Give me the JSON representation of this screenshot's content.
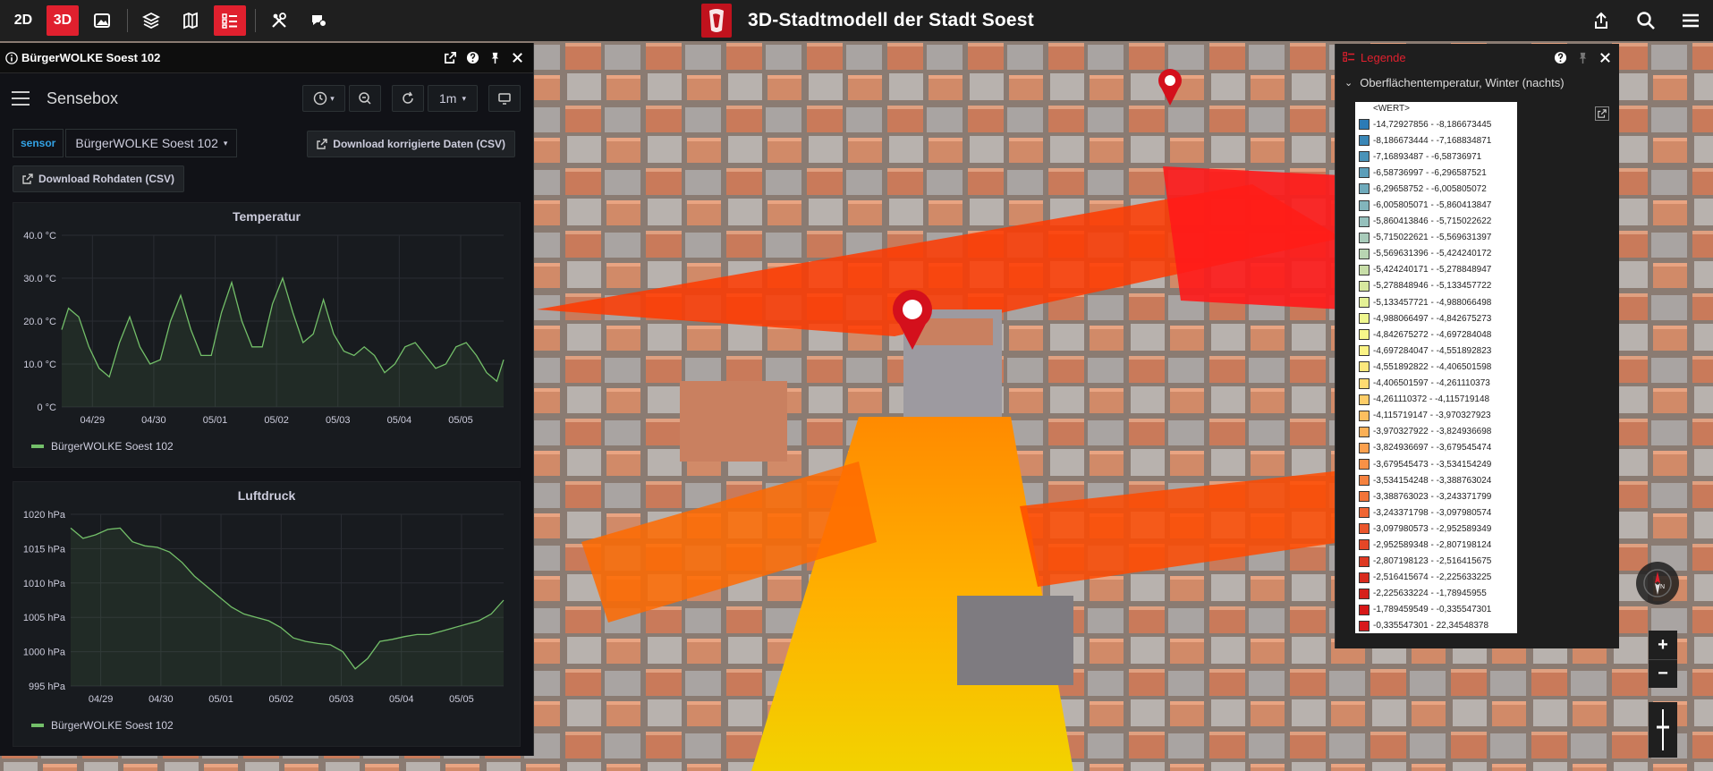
{
  "topbar": {
    "btn_2d": "2D",
    "btn_3d": "3D",
    "title": "3D-Stadtmodell der Stadt Soest",
    "accent": "#e0202e"
  },
  "left_panel": {
    "window_title": "BürgerWOLKE Soest 102",
    "dashboard_title": "Sensebox",
    "refresh_interval": "1m",
    "variable_label": "sensor",
    "variable_value": "BürgerWOLKE Soest 102",
    "download_corrected": "Download korrigierte Daten (CSV)",
    "download_raw": "Download Rohdaten (CSV)"
  },
  "chart_data": [
    {
      "type": "area",
      "title": "Temperatur",
      "ylim": [
        0,
        40
      ],
      "yticks": [
        "0 °C",
        "10.0 °C",
        "20.0 °C",
        "30.0 °C",
        "40.0 °C"
      ],
      "xticks": [
        "04/29",
        "04/30",
        "05/01",
        "05/02",
        "05/03",
        "05/04",
        "05/05"
      ],
      "series": [
        {
          "name": "BürgerWOLKE Soest 102",
          "color": "#73bf69",
          "x": [
            0,
            0.1,
            0.25,
            0.4,
            0.55,
            0.7,
            0.85,
            1.0,
            1.15,
            1.3,
            1.45,
            1.6,
            1.75,
            1.9,
            2.05,
            2.2,
            2.35,
            2.5,
            2.65,
            2.8,
            2.95,
            3.1,
            3.25,
            3.4,
            3.55,
            3.7,
            3.85,
            4.0,
            4.15,
            4.3,
            4.45,
            4.6,
            4.75,
            4.9,
            5.05,
            5.2,
            5.35,
            5.5,
            5.65,
            5.8,
            5.95,
            6.1,
            6.25,
            6.4,
            6.5
          ],
          "y": [
            18,
            23,
            21,
            14,
            9,
            7,
            15,
            21,
            14,
            10,
            11,
            20,
            26,
            18,
            12,
            12,
            22,
            29,
            20,
            14,
            14,
            24,
            30,
            22,
            15,
            17,
            25,
            17,
            13,
            12,
            14,
            12,
            8,
            10,
            14,
            15,
            12,
            9,
            10,
            14,
            15,
            12,
            8,
            6,
            11
          ]
        }
      ]
    },
    {
      "type": "area",
      "title": "Luftdruck",
      "ylim": [
        995,
        1020
      ],
      "yticks": [
        "995 hPa",
        "1000 hPa",
        "1005 hPa",
        "1010 hPa",
        "1015 hPa",
        "1020 hPa"
      ],
      "xticks": [
        "04/29",
        "04/30",
        "05/01",
        "05/02",
        "05/03",
        "05/04",
        "05/05"
      ],
      "series": [
        {
          "name": "BürgerWOLKE Soest 102",
          "color": "#73bf69",
          "x": [
            0,
            0.2,
            0.4,
            0.6,
            0.8,
            1.0,
            1.2,
            1.4,
            1.6,
            1.8,
            2.0,
            2.2,
            2.4,
            2.6,
            2.8,
            3.0,
            3.2,
            3.4,
            3.6,
            3.8,
            4.0,
            4.2,
            4.4,
            4.6,
            4.8,
            5.0,
            5.2,
            5.4,
            5.6,
            5.8,
            6.0,
            6.2,
            6.4,
            6.6,
            6.8,
            7.0
          ],
          "y": [
            1018,
            1016.5,
            1017,
            1017.8,
            1018,
            1016,
            1015.4,
            1015.2,
            1014.5,
            1013,
            1011,
            1009.5,
            1008,
            1006.5,
            1005.5,
            1005,
            1004.5,
            1003.5,
            1002,
            1001.5,
            1001.2,
            1001,
            1000,
            997.5,
            999,
            1001.5,
            1001.8,
            1002.2,
            1002.5,
            1002.5,
            1003,
            1003.5,
            1004,
            1004.5,
            1005.5,
            1007.5
          ]
        }
      ]
    }
  ],
  "legend_panel": {
    "title": "Legende",
    "layer_name": "Oberflächentemperatur, Winter (nachts)",
    "header": "<WERT>",
    "items": [
      {
        "label": "-14,72927856 - -8,186673445",
        "color": "#2c7bb6"
      },
      {
        "label": "-8,186673444 - -7,168834871",
        "color": "#3a87b7"
      },
      {
        "label": "-7,16893487 - -6,58736971",
        "color": "#4a93b8"
      },
      {
        "label": "-6,58736997 - -6,296587521",
        "color": "#5c9eb9"
      },
      {
        "label": "-6,29658752 - -6,005805072",
        "color": "#6faabb"
      },
      {
        "label": "-6,005805071 - -5,860413847",
        "color": "#82b5bc"
      },
      {
        "label": "-5,860413846 - -5,715022622",
        "color": "#95c0bc"
      },
      {
        "label": "-5,715022621 - -5,569631397",
        "color": "#a8cbba"
      },
      {
        "label": "-5,569631396 - -5,424240172",
        "color": "#b8d4b2"
      },
      {
        "label": "-5,424240171 - -5,278848947",
        "color": "#c8dea8"
      },
      {
        "label": "-5,278848946 - -5,133457722",
        "color": "#d7e89f"
      },
      {
        "label": "-5,133457721 - -4,988066498",
        "color": "#e4f196"
      },
      {
        "label": "-4,988066497 - -4,842675273",
        "color": "#eff78f"
      },
      {
        "label": "-4,842675272 - -4,697284048",
        "color": "#f6f78a"
      },
      {
        "label": "-4,697284047 - -4,551892823",
        "color": "#fbf385"
      },
      {
        "label": "-4,551892822 - -4,406501598",
        "color": "#fde87d"
      },
      {
        "label": "-4,406501597 - -4,261110373",
        "color": "#fedb72"
      },
      {
        "label": "-4,261110372 - -4,115719148",
        "color": "#fecd68"
      },
      {
        "label": "-4,115719147 - -3,970327923",
        "color": "#fdbf5f"
      },
      {
        "label": "-3,970327922 - -3,824936698",
        "color": "#fcb056"
      },
      {
        "label": "-3,824936697 - -3,679545474",
        "color": "#fba04e"
      },
      {
        "label": "-3,679545473 - -3,534154249",
        "color": "#f99146"
      },
      {
        "label": "-3,534154248 - -3,388763024",
        "color": "#f6823f"
      },
      {
        "label": "-3,388763023 - -3,243371799",
        "color": "#f37439"
      },
      {
        "label": "-3,243371798 - -3,097980574",
        "color": "#ef6533"
      },
      {
        "label": "-3,097980573 - -2,952589349",
        "color": "#ea562d"
      },
      {
        "label": "-2,952589348 - -2,807198124",
        "color": "#e44727"
      },
      {
        "label": "-2,807198123 - -2,516415675",
        "color": "#de3922"
      },
      {
        "label": "-2,516415674 - -2,225633225",
        "color": "#d82b1e"
      },
      {
        "label": "-2,225633224 - -1,78945955",
        "color": "#d61f1a"
      },
      {
        "label": "-1,789459549 - -0,335547301",
        "color": "#d71717"
      },
      {
        "label": "-0,335547301 - 22,34548378",
        "color": "#d7191c"
      }
    ]
  }
}
